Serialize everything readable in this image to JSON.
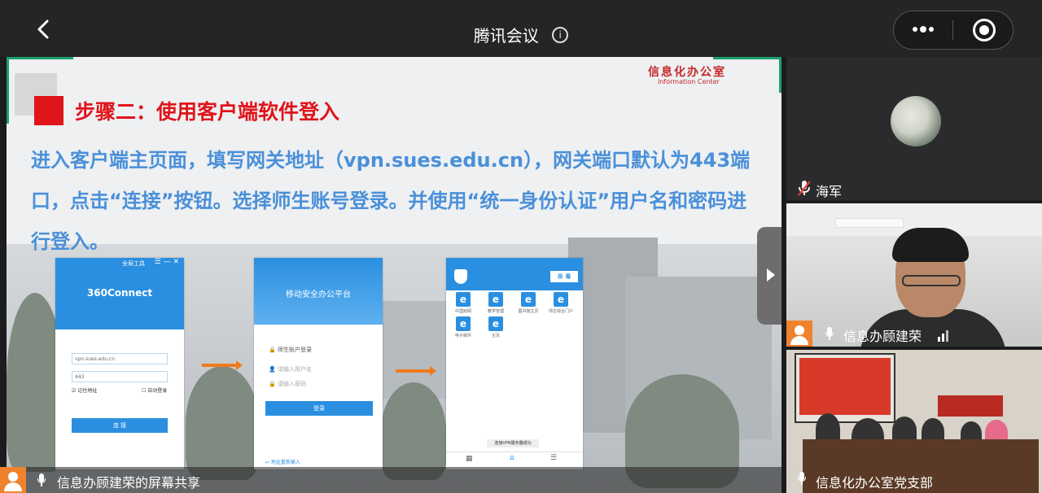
{
  "topbar": {
    "title": "腾讯会议",
    "info_icon": "info-icon",
    "back_icon": "chevron-left-icon",
    "more_icon": "more-dots-icon",
    "record_icon": "record-icon"
  },
  "slide": {
    "logo_cn": "信息化办公室",
    "logo_en": "Information Center",
    "step_title": "步骤二：使用客户端软件登入",
    "paragraph": "进入客户端主页面，填写网关地址（vpn.sues.edu.cn），网关端口默认为443端口，点击“连接”按钮。选择师生账号登录。并使用“统一身份认证”用户名和密码进行登入。",
    "phone1": {
      "window_title": "全局工具",
      "window_controls": "☰ — ✕",
      "brand": "360Connect",
      "gateway_value": "vpn.sues.edu.cn",
      "port_value": "443",
      "remember_label": "记住地址",
      "auto_login_label": "自动登录",
      "connect_button": "连 接"
    },
    "phone2": {
      "header_title": "移动安全办公平台",
      "account_login": "师生账户登录",
      "username_placeholder": "请输入用户名",
      "password_placeholder": "请输入密码",
      "login_button": "登录",
      "footer_link": "↩ 地址重新输入"
    },
    "phone3": {
      "kill_button": "杀 毒",
      "apps": [
        {
          "label": "中国知网"
        },
        {
          "label": "教学管理"
        },
        {
          "label": "图书馆主页"
        },
        {
          "label": "师生综合门户"
        },
        {
          "label": "电子邮件"
        },
        {
          "label": "主页"
        }
      ],
      "toast": "连接VPN服务器成功"
    }
  },
  "share_caption": "信息办顾建荣的屏幕共享",
  "participants": [
    {
      "name": "海军",
      "mic": "mic-muted-icon"
    },
    {
      "name": "信息办顾建荣",
      "mic": "mic-icon",
      "signal": "signal-bars-icon"
    },
    {
      "name": "信息化办公室党支部",
      "mic": "mic-icon"
    }
  ],
  "colors": {
    "accent_blue": "#2a8fe0",
    "title_red": "#e0141b",
    "para_blue": "#4a90d9",
    "avatar_orange": "#f0822d"
  }
}
